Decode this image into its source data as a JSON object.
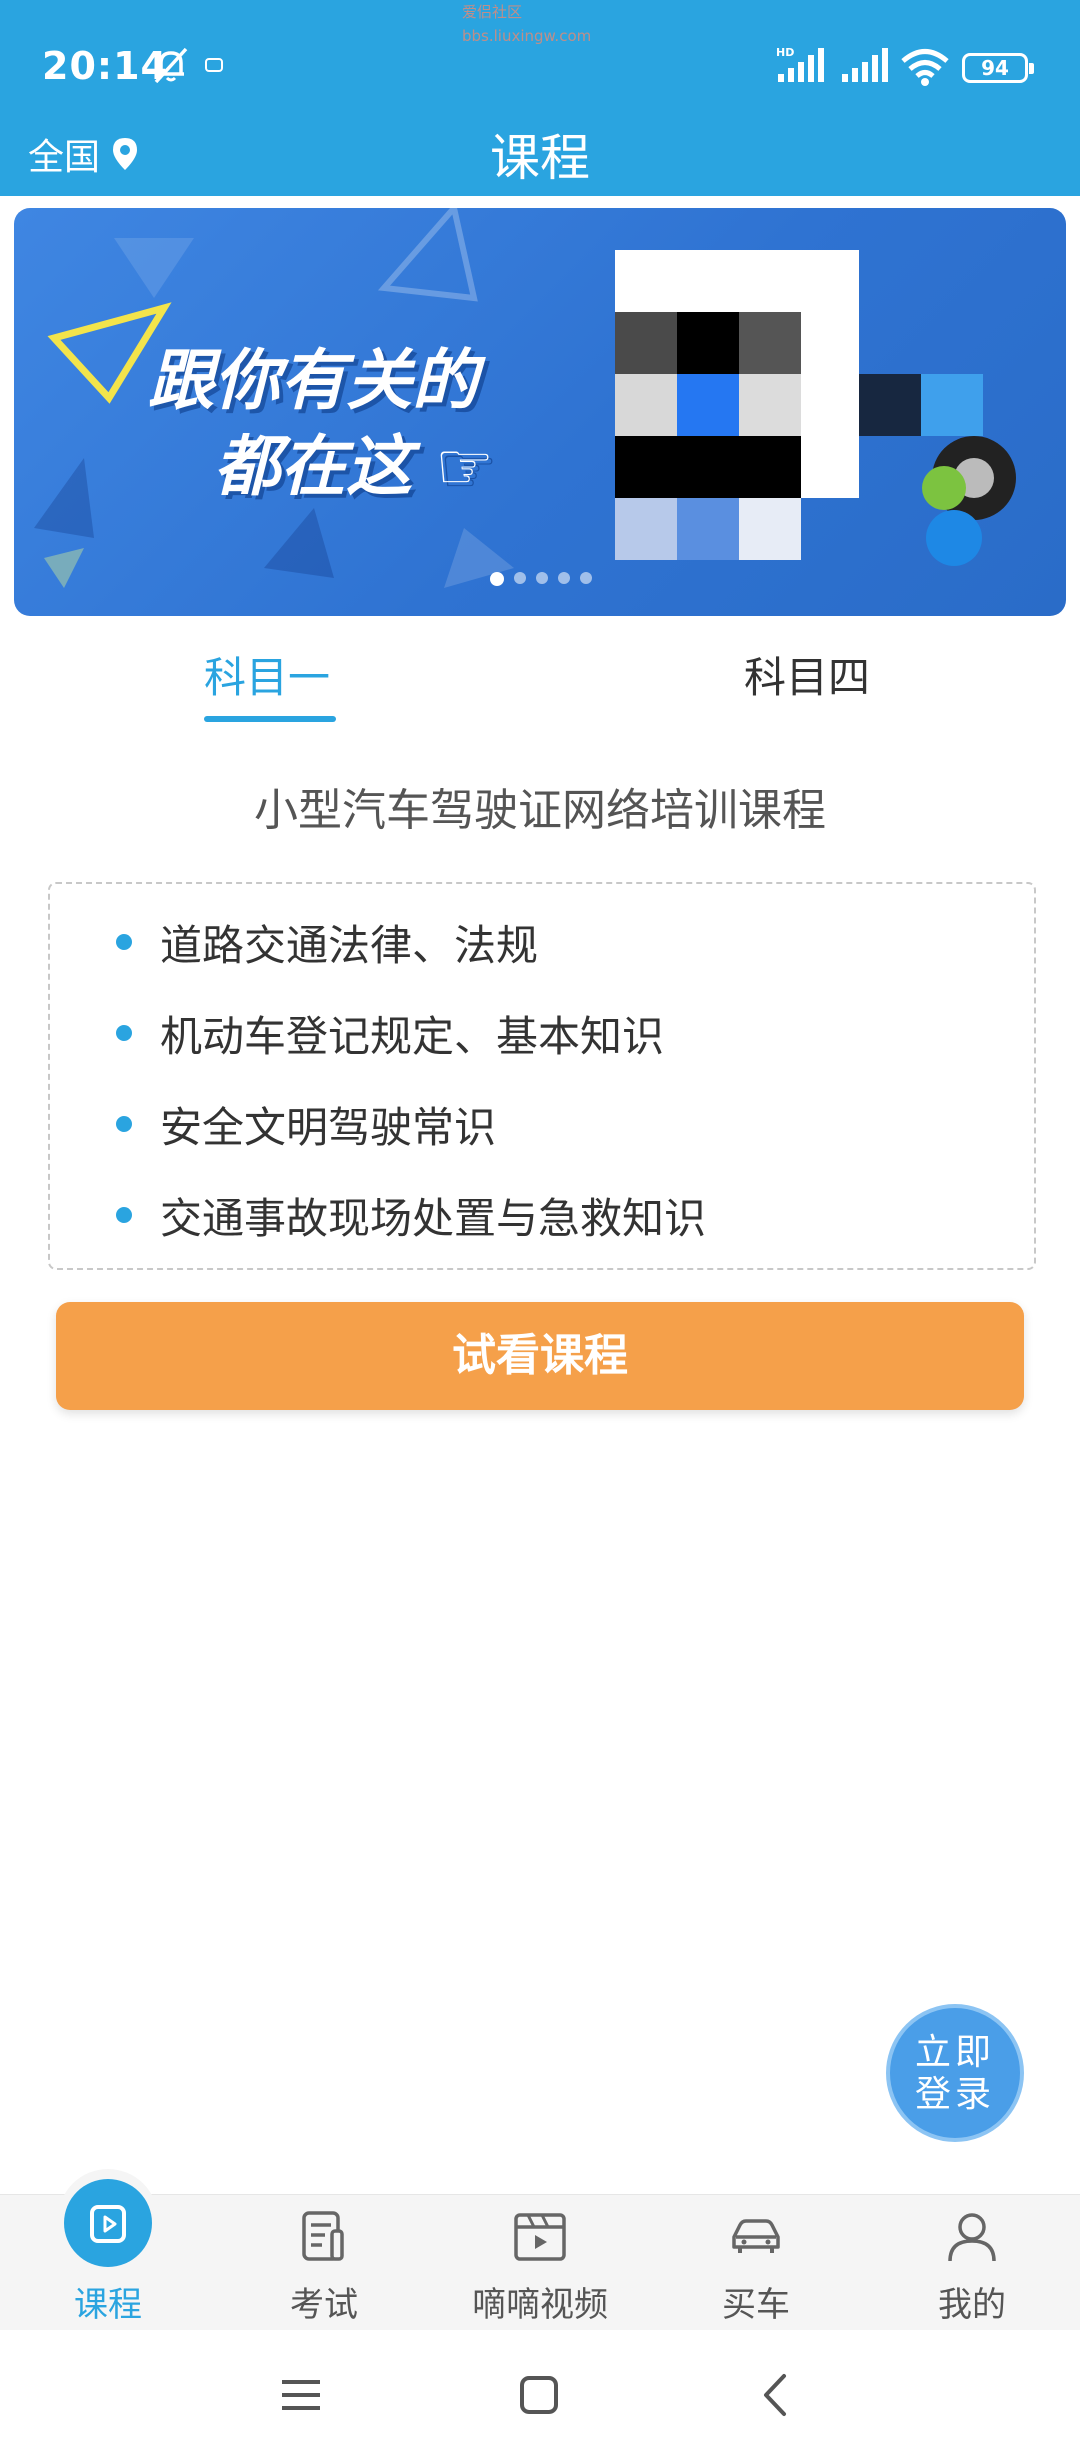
{
  "status_bar": {
    "time": "20:14",
    "watermark_line1": "爱侣社区",
    "watermark_line2": "bbs.liuxingw.com",
    "battery": "94",
    "icons": [
      "bell-off-icon",
      "notification-icon",
      "signal-hd-icon",
      "signal-icon",
      "wifi-icon",
      "battery-icon"
    ]
  },
  "header": {
    "region_label": "全国",
    "region_icon": "location-pin-icon",
    "title": "课程"
  },
  "banner": {
    "line1": "跟你有关的",
    "line2": "都在这",
    "dots_total": 5,
    "dots_active_index": 0
  },
  "tabs": [
    {
      "label": "科目一",
      "active": true
    },
    {
      "label": "科目四",
      "active": false
    }
  ],
  "course": {
    "title": "小型汽车驾驶证网络培训课程",
    "items": [
      "道路交通法律、法规",
      "机动车登记规定、基本知识",
      "安全文明驾驶常识",
      "交通事故现场处置与急救知识"
    ],
    "trial_button": "试看课程"
  },
  "login_fab": {
    "line1": "立即",
    "line2": "登录"
  },
  "bottom_nav": [
    {
      "label": "课程",
      "icon": "course-video-icon",
      "active": true
    },
    {
      "label": "考试",
      "icon": "exam-icon",
      "active": false
    },
    {
      "label": "嘀嘀视频",
      "icon": "video-clapper-icon",
      "active": false
    },
    {
      "label": "买车",
      "icon": "car-icon",
      "active": false
    },
    {
      "label": "我的",
      "icon": "user-icon",
      "active": false
    }
  ],
  "system_nav": [
    "menu-icon",
    "home-icon",
    "back-icon"
  ],
  "colors": {
    "primary": "#2aa4e0",
    "button": "#f5a04a",
    "fab": "#4a9ee8"
  }
}
